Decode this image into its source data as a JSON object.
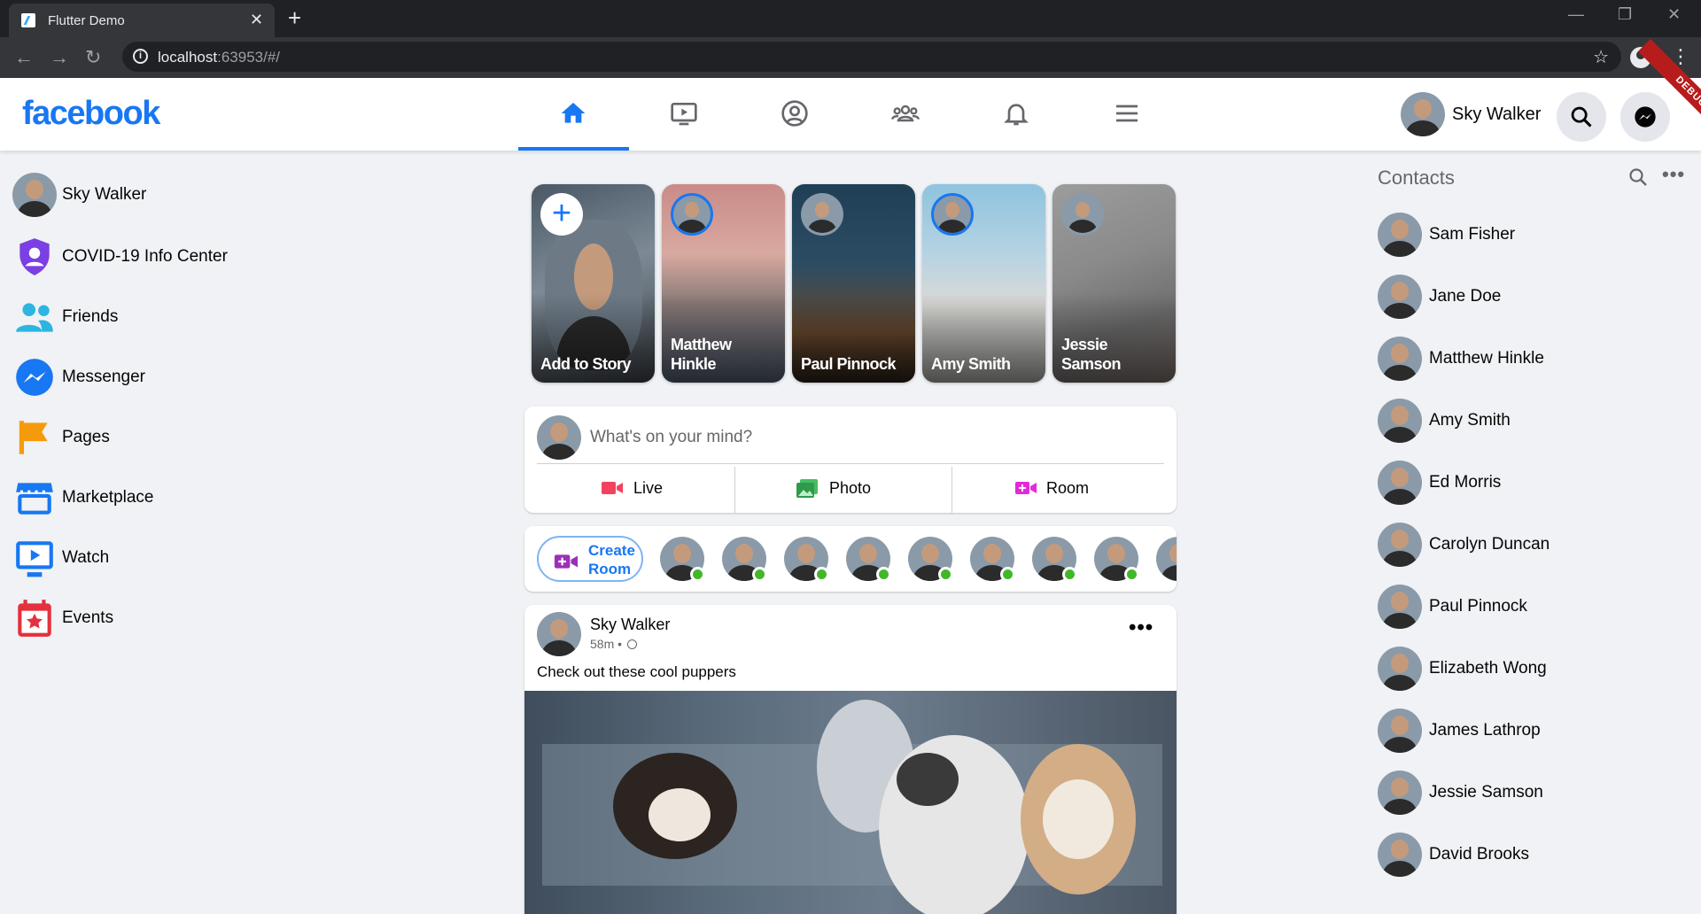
{
  "browser": {
    "tab_title": "Flutter Demo",
    "tab_close": "✕",
    "new_tab": "+",
    "url_host": "localhost",
    "url_rest": ":63953/#/",
    "window_controls": [
      "—",
      "❐",
      "✕"
    ]
  },
  "appbar": {
    "logo": "facebook",
    "nav_tabs": [
      "home-icon",
      "watch-icon",
      "profile-icon",
      "groups-icon",
      "notifications-icon",
      "menu-icon"
    ],
    "active_tab": 0,
    "user_name": "Sky Walker",
    "debug_banner": "DEBUG"
  },
  "sidebar": {
    "user": "Sky Walker",
    "items": [
      {
        "label": "COVID-19 Info Center",
        "icon": "shield-icon",
        "color": "#7b3fe4"
      },
      {
        "label": "Friends",
        "icon": "friends-icon",
        "color": "#2bb5e0"
      },
      {
        "label": "Messenger",
        "icon": "messenger-icon",
        "color": "#1877f2"
      },
      {
        "label": "Pages",
        "icon": "flag-icon",
        "color": "#f59b0b"
      },
      {
        "label": "Marketplace",
        "icon": "store-icon",
        "color": "#1877f2"
      },
      {
        "label": "Watch",
        "icon": "watch-icon",
        "color": "#1877f2"
      },
      {
        "label": "Events",
        "icon": "calendar-icon",
        "color": "#e4313d"
      }
    ]
  },
  "stories": [
    {
      "name": "Add to Story",
      "add": true
    },
    {
      "name": "Matthew Hinkle",
      "ring": true
    },
    {
      "name": "Paul Pinnock",
      "ring": false
    },
    {
      "name": "Amy Smith",
      "ring": true
    },
    {
      "name": "Jessie Samson",
      "ring": false
    }
  ],
  "composer": {
    "placeholder": "What's on your mind?",
    "actions": [
      {
        "label": "Live",
        "icon": "video-icon",
        "color": "#f3425f"
      },
      {
        "label": "Photo",
        "icon": "photo-icon",
        "color": "#45bd62"
      },
      {
        "label": "Room",
        "icon": "room-icon",
        "color": "#e42ad8"
      }
    ]
  },
  "rooms": {
    "create_label_1": "Create",
    "create_label_2": "Room"
  },
  "post": {
    "author": "Sky Walker",
    "time": "58m",
    "separator": "•",
    "caption": "Check out these cool puppers",
    "more": "•••"
  },
  "contacts": {
    "title": "Contacts",
    "more": "•••",
    "items": [
      "Sam Fisher",
      "Jane Doe",
      "Matthew Hinkle",
      "Amy Smith",
      "Ed Morris",
      "Carolyn Duncan",
      "Paul Pinnock",
      "Elizabeth Wong",
      "James Lathrop",
      "Jessie Samson",
      "David Brooks"
    ]
  },
  "colors": {
    "brand": "#1877f2",
    "online": "#42b72a",
    "background": "#f0f2f5"
  }
}
